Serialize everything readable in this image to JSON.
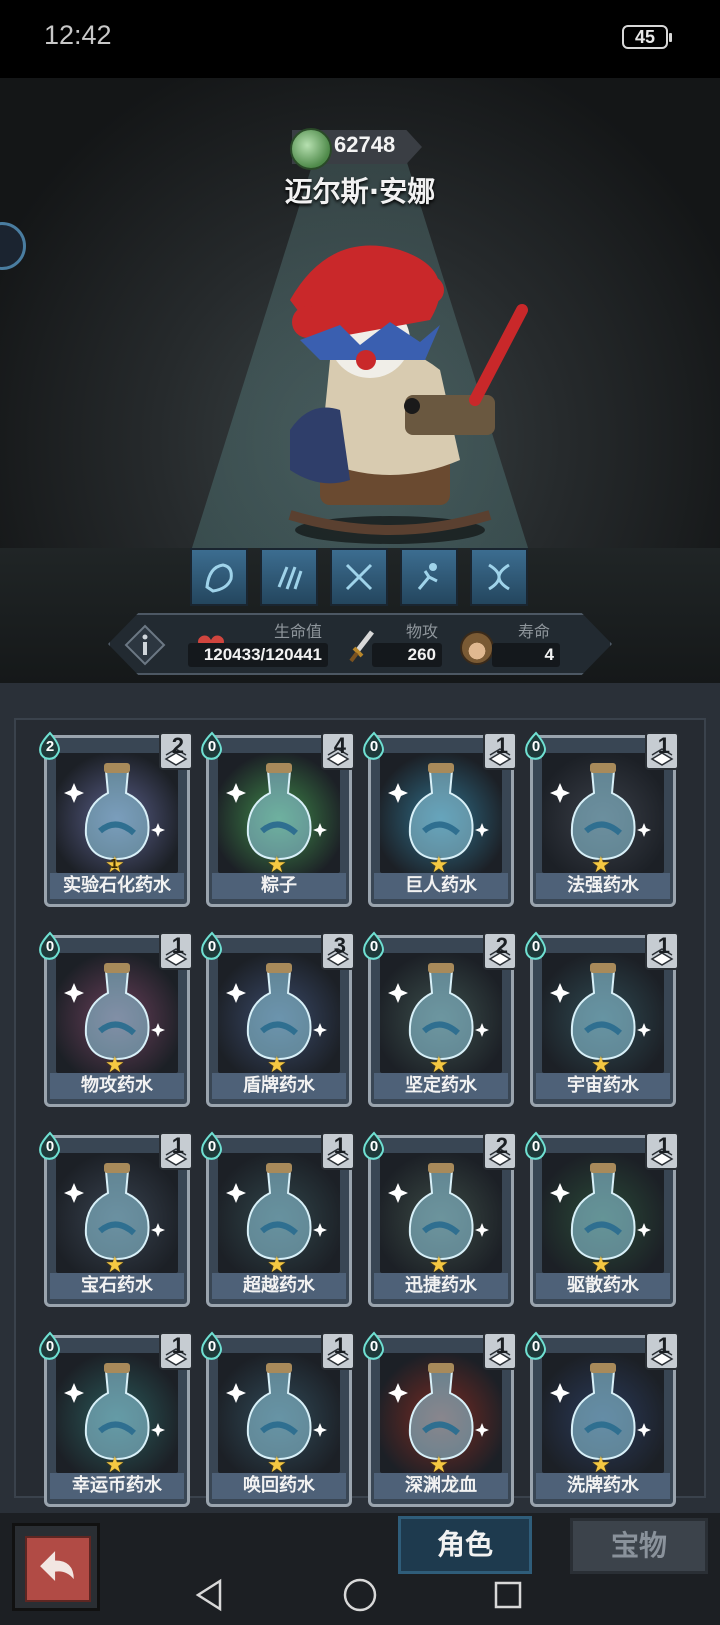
{
  "status_bar": {
    "time": "12:42",
    "battery": "45"
  },
  "hero": {
    "currency": "62748",
    "name": "迈尔斯·安娜",
    "skills": [
      "skill-1",
      "skill-2",
      "skill-3",
      "skill-4",
      "skill-5"
    ],
    "stats": {
      "hp_label": "生命值",
      "hp_value": "120433/120441",
      "atk_label": "物攻",
      "atk_value": "260",
      "life_label": "寿命",
      "life_value": "4"
    }
  },
  "items": [
    {
      "name": "实验石化药水",
      "cost": "2",
      "count": "2",
      "star_num": "1",
      "color": "#5a5f8a"
    },
    {
      "name": "粽子",
      "cost": "0",
      "count": "4",
      "star_num": "",
      "color": "#3f8a4a"
    },
    {
      "name": "巨人药水",
      "cost": "0",
      "count": "1",
      "star_num": "",
      "color": "#2f6f8a"
    },
    {
      "name": "法强药水",
      "cost": "0",
      "count": "1",
      "star_num": "",
      "color": "#3a3f48"
    },
    {
      "name": "物攻药水",
      "cost": "0",
      "count": "1",
      "star_num": "",
      "color": "#6a3f5a"
    },
    {
      "name": "盾牌药水",
      "cost": "0",
      "count": "3",
      "star_num": "",
      "color": "#3a4a6a"
    },
    {
      "name": "坚定药水",
      "cost": "0",
      "count": "2",
      "star_num": "",
      "color": "#3c4f4c"
    },
    {
      "name": "宇宙药水",
      "cost": "0",
      "count": "1",
      "star_num": "",
      "color": "#2f4a52"
    },
    {
      "name": "宝石药水",
      "cost": "0",
      "count": "1",
      "star_num": "",
      "color": "#38424f"
    },
    {
      "name": "超越药水",
      "cost": "0",
      "count": "1",
      "star_num": "",
      "color": "#30454a"
    },
    {
      "name": "迅捷药水",
      "cost": "0",
      "count": "2",
      "star_num": "",
      "color": "#3b4a45"
    },
    {
      "name": "驱散药水",
      "cost": "0",
      "count": "1",
      "star_num": "",
      "color": "#2a4a38"
    },
    {
      "name": "幸运币药水",
      "cost": "0",
      "count": "1",
      "star_num": "",
      "color": "#2a5a5a"
    },
    {
      "name": "唤回药水",
      "cost": "0",
      "count": "1",
      "star_num": "",
      "color": "#304a58"
    },
    {
      "name": "深渊龙血",
      "cost": "0",
      "count": "1",
      "star_num": "",
      "color": "#7a2a22"
    },
    {
      "name": "洗牌药水",
      "cost": "0",
      "count": "1",
      "star_num": "",
      "color": "#2a3a5a"
    }
  ],
  "tabs": {
    "role": "角色",
    "treasure": "宝物"
  },
  "colors": {
    "accent": "#4aa3b8",
    "panel": "#2a3038",
    "star": "#f5c842"
  }
}
